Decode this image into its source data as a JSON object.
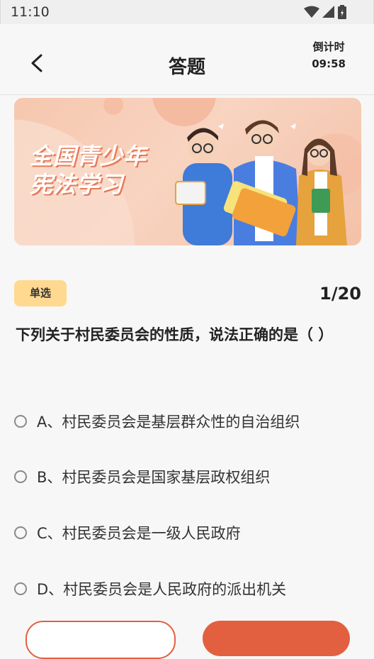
{
  "status": {
    "time": "11:10",
    "icons": [
      "wifi-icon",
      "signal-icon",
      "battery-icon"
    ]
  },
  "header": {
    "title": "答题",
    "countdown_label": "倒计时",
    "countdown_time": "09:58"
  },
  "banner": {
    "line1": "全国青少年",
    "line2": "宪法学习"
  },
  "question": {
    "type": "单选",
    "progress": "1/20",
    "text": "下列关于村民委员会的性质，说法正确的是（ ）",
    "options": [
      {
        "label": "A、村民委员会是基层群众性的自治组织"
      },
      {
        "label": "B、村民委员会是国家基层政权组织"
      },
      {
        "label": "C、村民委员会是一级人民政府"
      },
      {
        "label": "D、村民委员会是人民政府的派出机关"
      }
    ]
  },
  "colors": {
    "accent": "#e2603f",
    "badge": "#ffd98f",
    "background": "#f7f7f7"
  }
}
